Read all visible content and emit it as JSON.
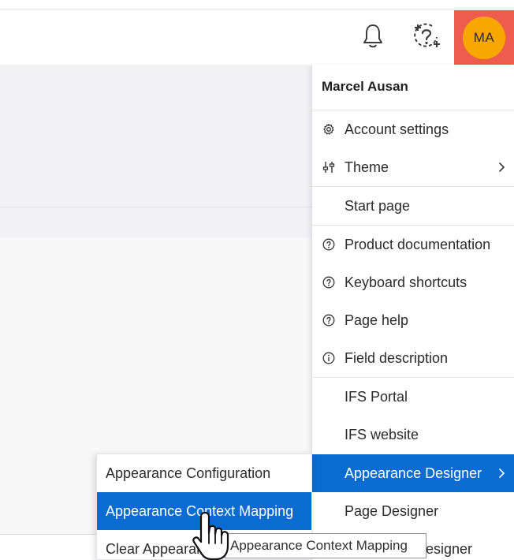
{
  "header": {
    "notifications_icon": "bell-icon",
    "help_icon": "question-circle-plus-icon",
    "user_initials": "MA"
  },
  "user_menu": {
    "user_name": "Marcel Ausan",
    "items": [
      {
        "label": "Account settings",
        "icon": "gear-icon"
      },
      {
        "label": "Theme",
        "icon": "sliders-icon",
        "submenu": true
      },
      {
        "label": "Start page"
      },
      {
        "label": "Product documentation",
        "icon": "question-circle-icon"
      },
      {
        "label": "Keyboard shortcuts",
        "icon": "question-circle-icon"
      },
      {
        "label": "Page help",
        "icon": "question-circle-icon"
      },
      {
        "label": "Field description",
        "icon": "info-circle-icon"
      },
      {
        "label": "IFS Portal"
      },
      {
        "label": "IFS website"
      },
      {
        "label": "Appearance Designer",
        "submenu": true,
        "active": true
      },
      {
        "label": "Page Designer"
      },
      {
        "label": "Designer",
        "partially_hidden": true
      }
    ]
  },
  "appearance_submenu": {
    "items": [
      {
        "label": "Appearance Configuration"
      },
      {
        "label": "Appearance Context Mapping",
        "active": true
      },
      {
        "label": "Clear Appearance"
      }
    ]
  },
  "tooltip": {
    "text": "Appearance Context Mapping"
  },
  "colors": {
    "accent": "#0a6bd0",
    "avatar_bg": "#f8a700",
    "avatar_highlight": "#ed5c4d"
  }
}
